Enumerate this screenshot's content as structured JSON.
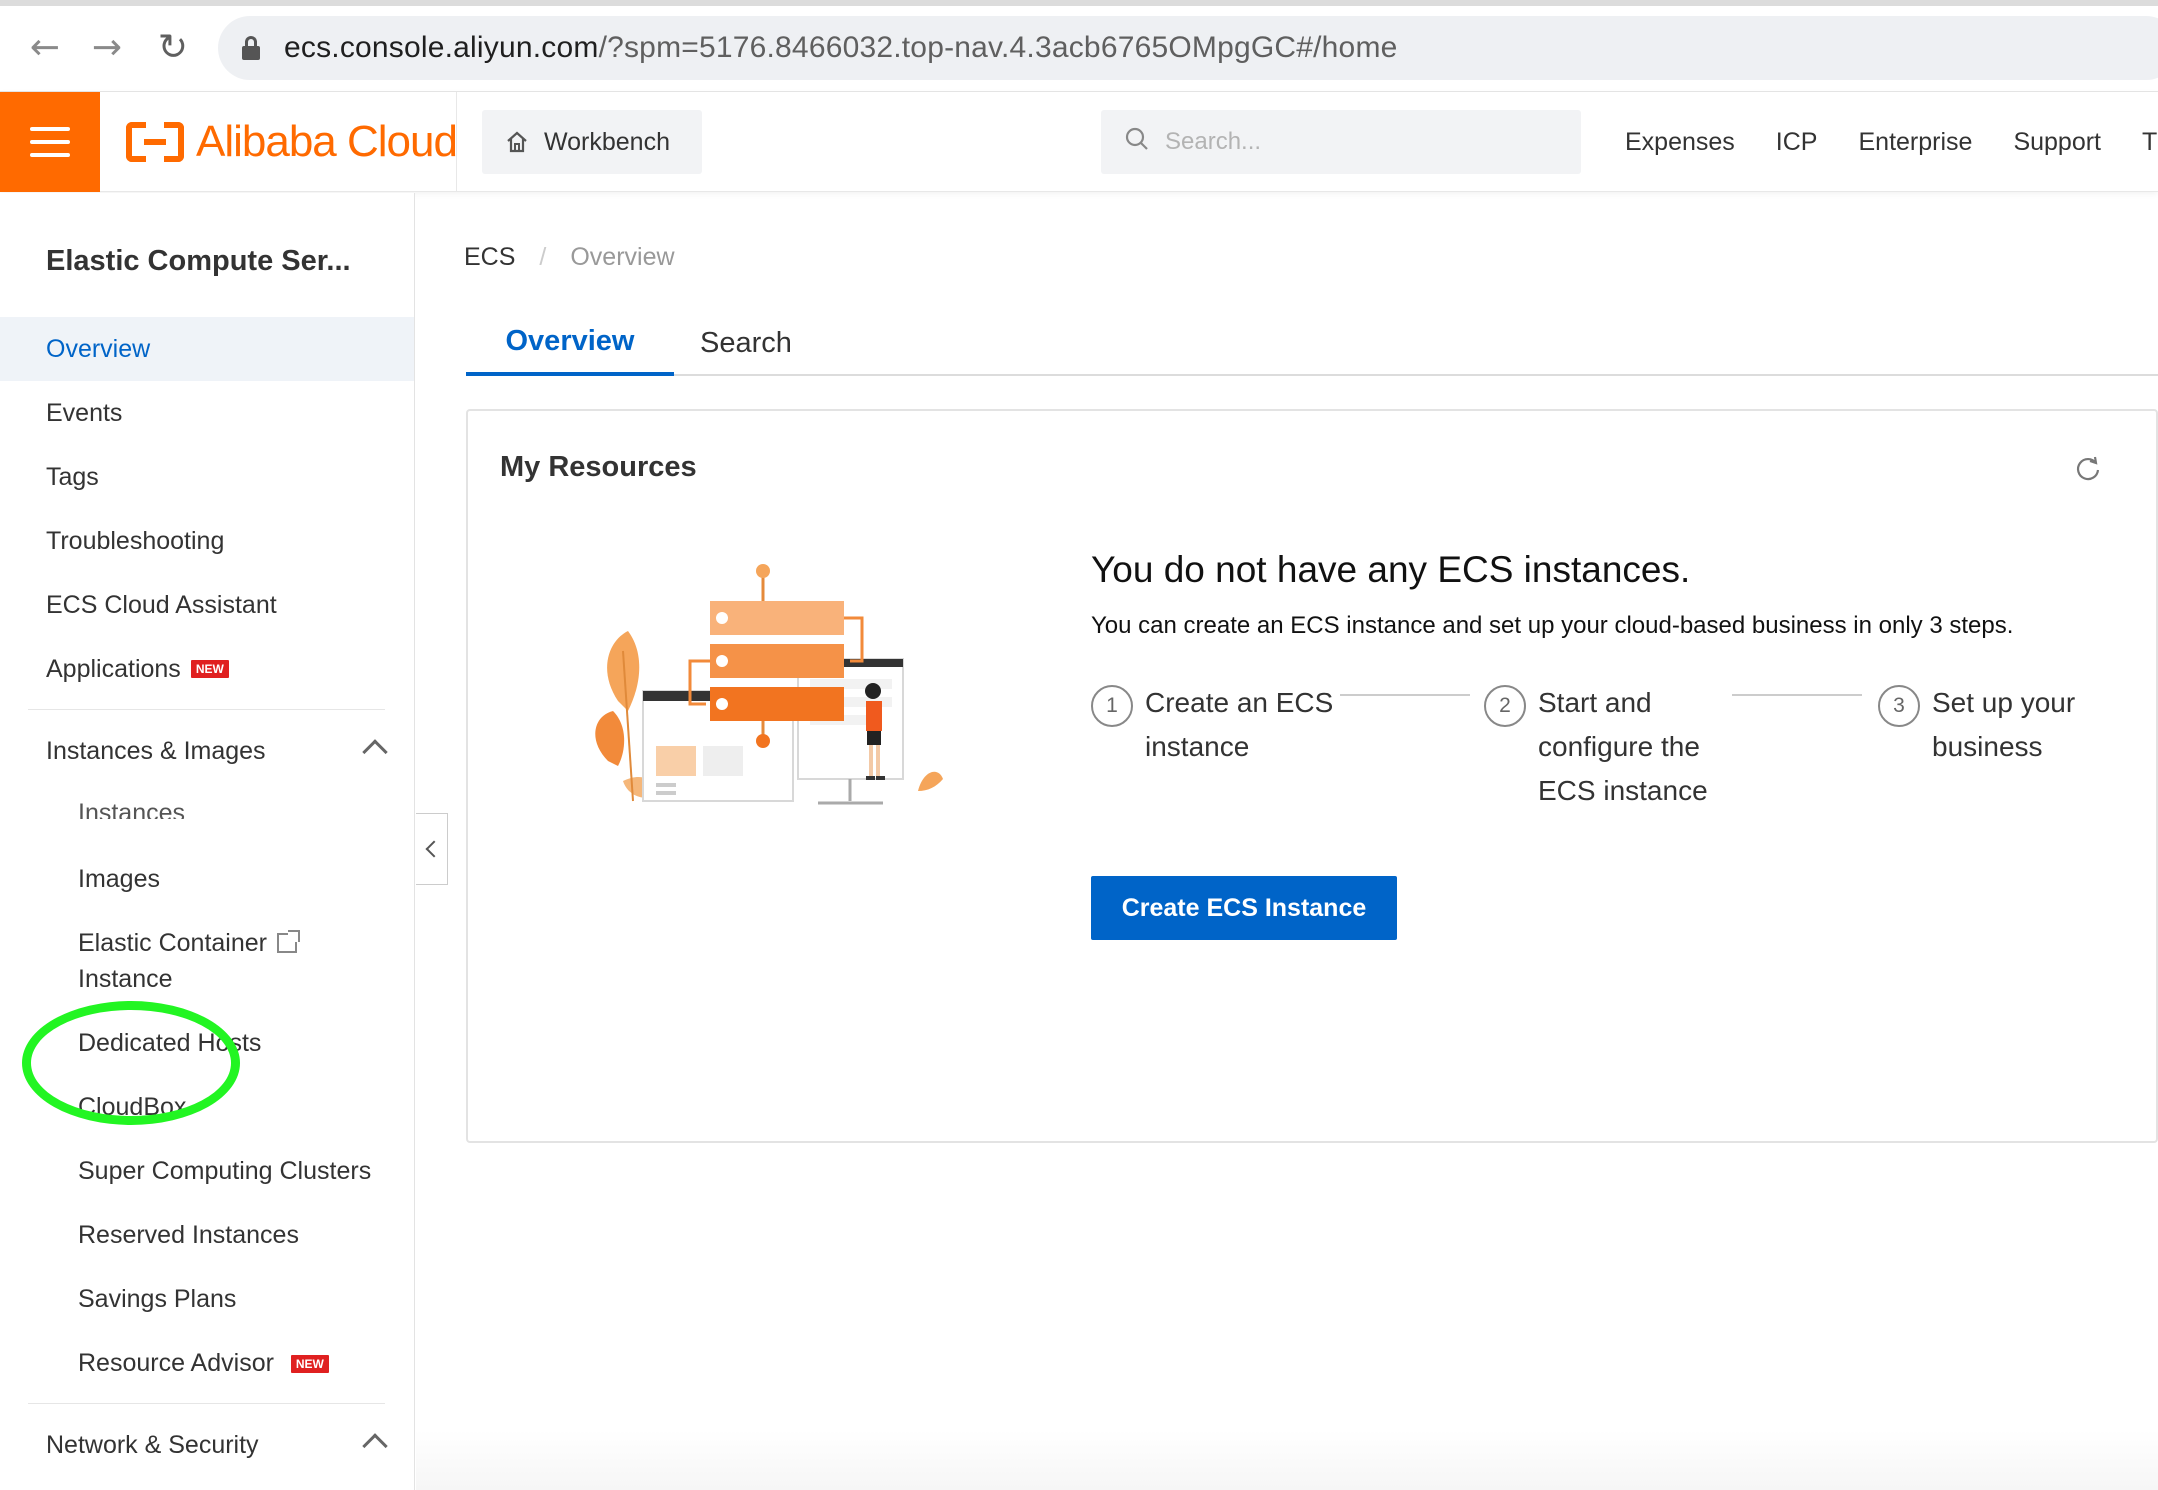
{
  "browser": {
    "url_host": "ecs.console.aliyun.com",
    "url_path": "/?spm=5176.8466032.top-nav.4.3acb6765OMpgGC#/home"
  },
  "topnav": {
    "logo_text": "Alibaba Cloud",
    "workbench_label": "Workbench",
    "search_placeholder": "Search...",
    "links": [
      "Expenses",
      "ICP",
      "Enterprise",
      "Support",
      "Ti"
    ]
  },
  "sidebar": {
    "title": "Elastic Compute Ser...",
    "items": [
      {
        "label": "Overview",
        "active": true
      },
      {
        "label": "Events"
      },
      {
        "label": "Tags"
      },
      {
        "label": "Troubleshooting"
      },
      {
        "label": "ECS Cloud Assistant"
      },
      {
        "label": "Applications",
        "badge": "NEW"
      }
    ],
    "group_instances": {
      "label": "Instances & Images",
      "children": [
        {
          "label": "Instances"
        },
        {
          "label": "Images"
        },
        {
          "label": "Elastic Container Instance",
          "line1": "Elastic Container",
          "line2": "Instance"
        },
        {
          "label": "Dedicated Hosts"
        },
        {
          "label": "CloudBox"
        },
        {
          "label": "Super Computing Clusters"
        },
        {
          "label": "Reserved Instances"
        },
        {
          "label": "Savings Plans"
        },
        {
          "label": "Resource Advisor",
          "badge": "NEW"
        }
      ]
    },
    "group_network": {
      "label": "Network & Security"
    }
  },
  "breadcrumb": {
    "root": "ECS",
    "sep": "/",
    "current": "Overview"
  },
  "tabs": [
    {
      "label": "Overview",
      "active": true
    },
    {
      "label": "Search"
    }
  ],
  "card": {
    "title": "My Resources",
    "empty_title": "You do not have any ECS instances.",
    "empty_desc": "You can create an ECS instance and set up your cloud-based business in only 3 steps.",
    "steps": [
      {
        "num": "1",
        "text": "Create an ECS instance"
      },
      {
        "num": "2",
        "text": "Start and configure the ECS instance"
      },
      {
        "num": "3",
        "text": "Set up your business"
      }
    ],
    "create_button": "Create ECS Instance"
  },
  "colors": {
    "brand_orange": "#ff6a00",
    "primary_blue": "#0064c8",
    "highlight_green": "#22f522"
  }
}
